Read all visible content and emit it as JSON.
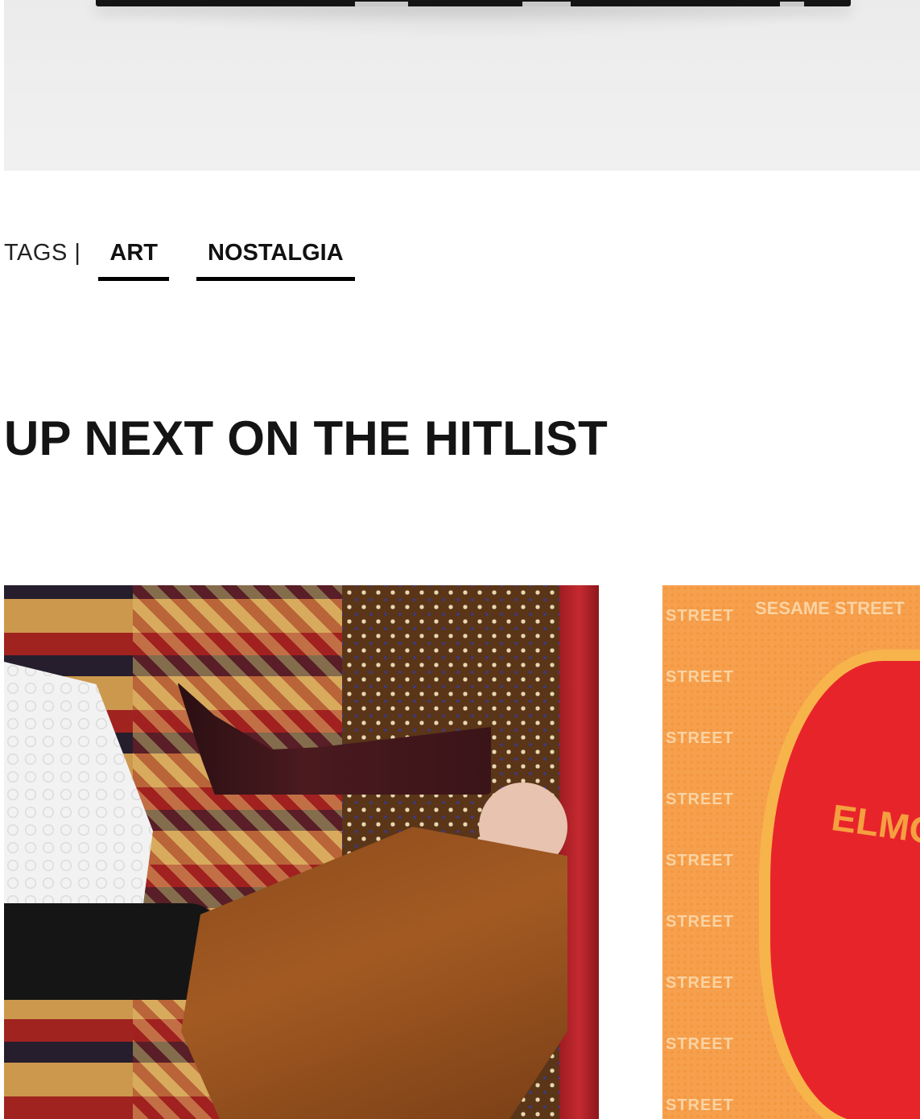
{
  "tags": {
    "label": "TAGS |",
    "items": [
      {
        "label": "ART"
      },
      {
        "label": "NOSTALGIA"
      }
    ]
  },
  "section": {
    "title": "UP NEXT ON THE HITLIST"
  },
  "cards": {
    "right": {
      "street_text": "STREET",
      "sesame_text": "SESAME STREET",
      "elmo_text": "ELMO"
    }
  },
  "colors": {
    "text_primary": "#141414",
    "tag_underline": "#000000",
    "hero_bg": "#efefef"
  }
}
